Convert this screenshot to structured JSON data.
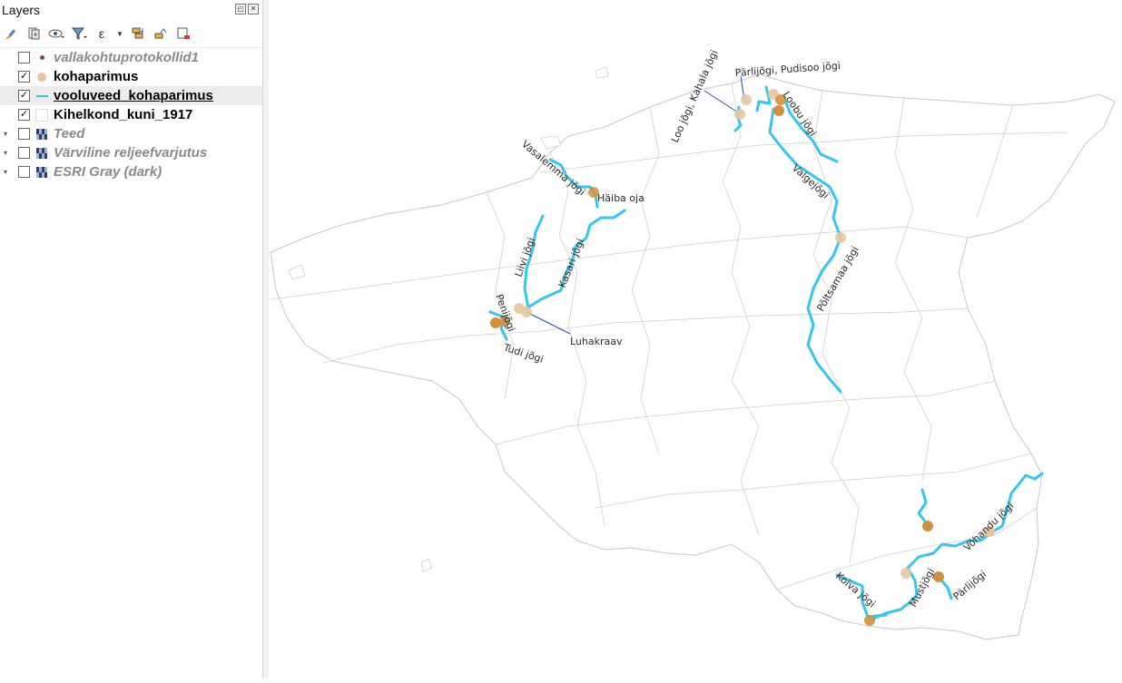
{
  "panel": {
    "title": "Layers",
    "float_button": "◰",
    "close_button": "✕"
  },
  "toolbar": {
    "icons": [
      "style-brush-icon",
      "add-group-icon",
      "visibility-icon",
      "filter-icon",
      "expression-filter-icon",
      "expand-all-icon",
      "collapse-all-icon",
      "remove-layer-icon"
    ],
    "expression_glyph": "ε"
  },
  "layers": [
    {
      "name": "vallakohtuprotokollid1",
      "checked": false,
      "symbol": "small-dot",
      "color": "#8b4a2f",
      "style": "dim"
    },
    {
      "name": "kohaparimus",
      "checked": true,
      "symbol": "big-dot",
      "color": "#e8c59e",
      "style": "on"
    },
    {
      "name": "vooluveed_kohaparimus",
      "checked": true,
      "symbol": "line",
      "color": "#35c6ef",
      "style": "on-underline",
      "selected": true
    },
    {
      "name": "Kihelkond_kuni_1917",
      "checked": true,
      "symbol": "empty",
      "color": "#ffffff",
      "style": "on"
    },
    {
      "name": "Teed",
      "checked": false,
      "symbol": "raster",
      "style": "dim",
      "expander": "▾"
    },
    {
      "name": "Värviline reljeefvarjutus",
      "checked": false,
      "symbol": "raster",
      "style": "dim",
      "expander": "▾"
    },
    {
      "name": "ESRI Gray (dark)",
      "checked": false,
      "symbol": "raster",
      "style": "dim",
      "expander": "▾"
    }
  ],
  "checkmark": "✓",
  "map": {
    "river_color": "#35c6ef",
    "point_color": "#d2913f",
    "point_light_color": "#e8c59e",
    "labels": [
      "Loo jõgi, Kahala jõgi",
      "Pärlijõgi, Pudisoo jõgi",
      "Loobu jõgi",
      "Vasalemma jõgi",
      "Häiba oja",
      "Valgejõgi",
      "Liivi jõgi",
      "Kasari jõgi",
      "Põltsamaa jõgi",
      "Penijõgi",
      "Luhakraav",
      "Tudi jõgi",
      "Võhandu jõgi",
      "Koiva jõgi",
      "Mustjõgi",
      "Pärlijõgi"
    ]
  }
}
